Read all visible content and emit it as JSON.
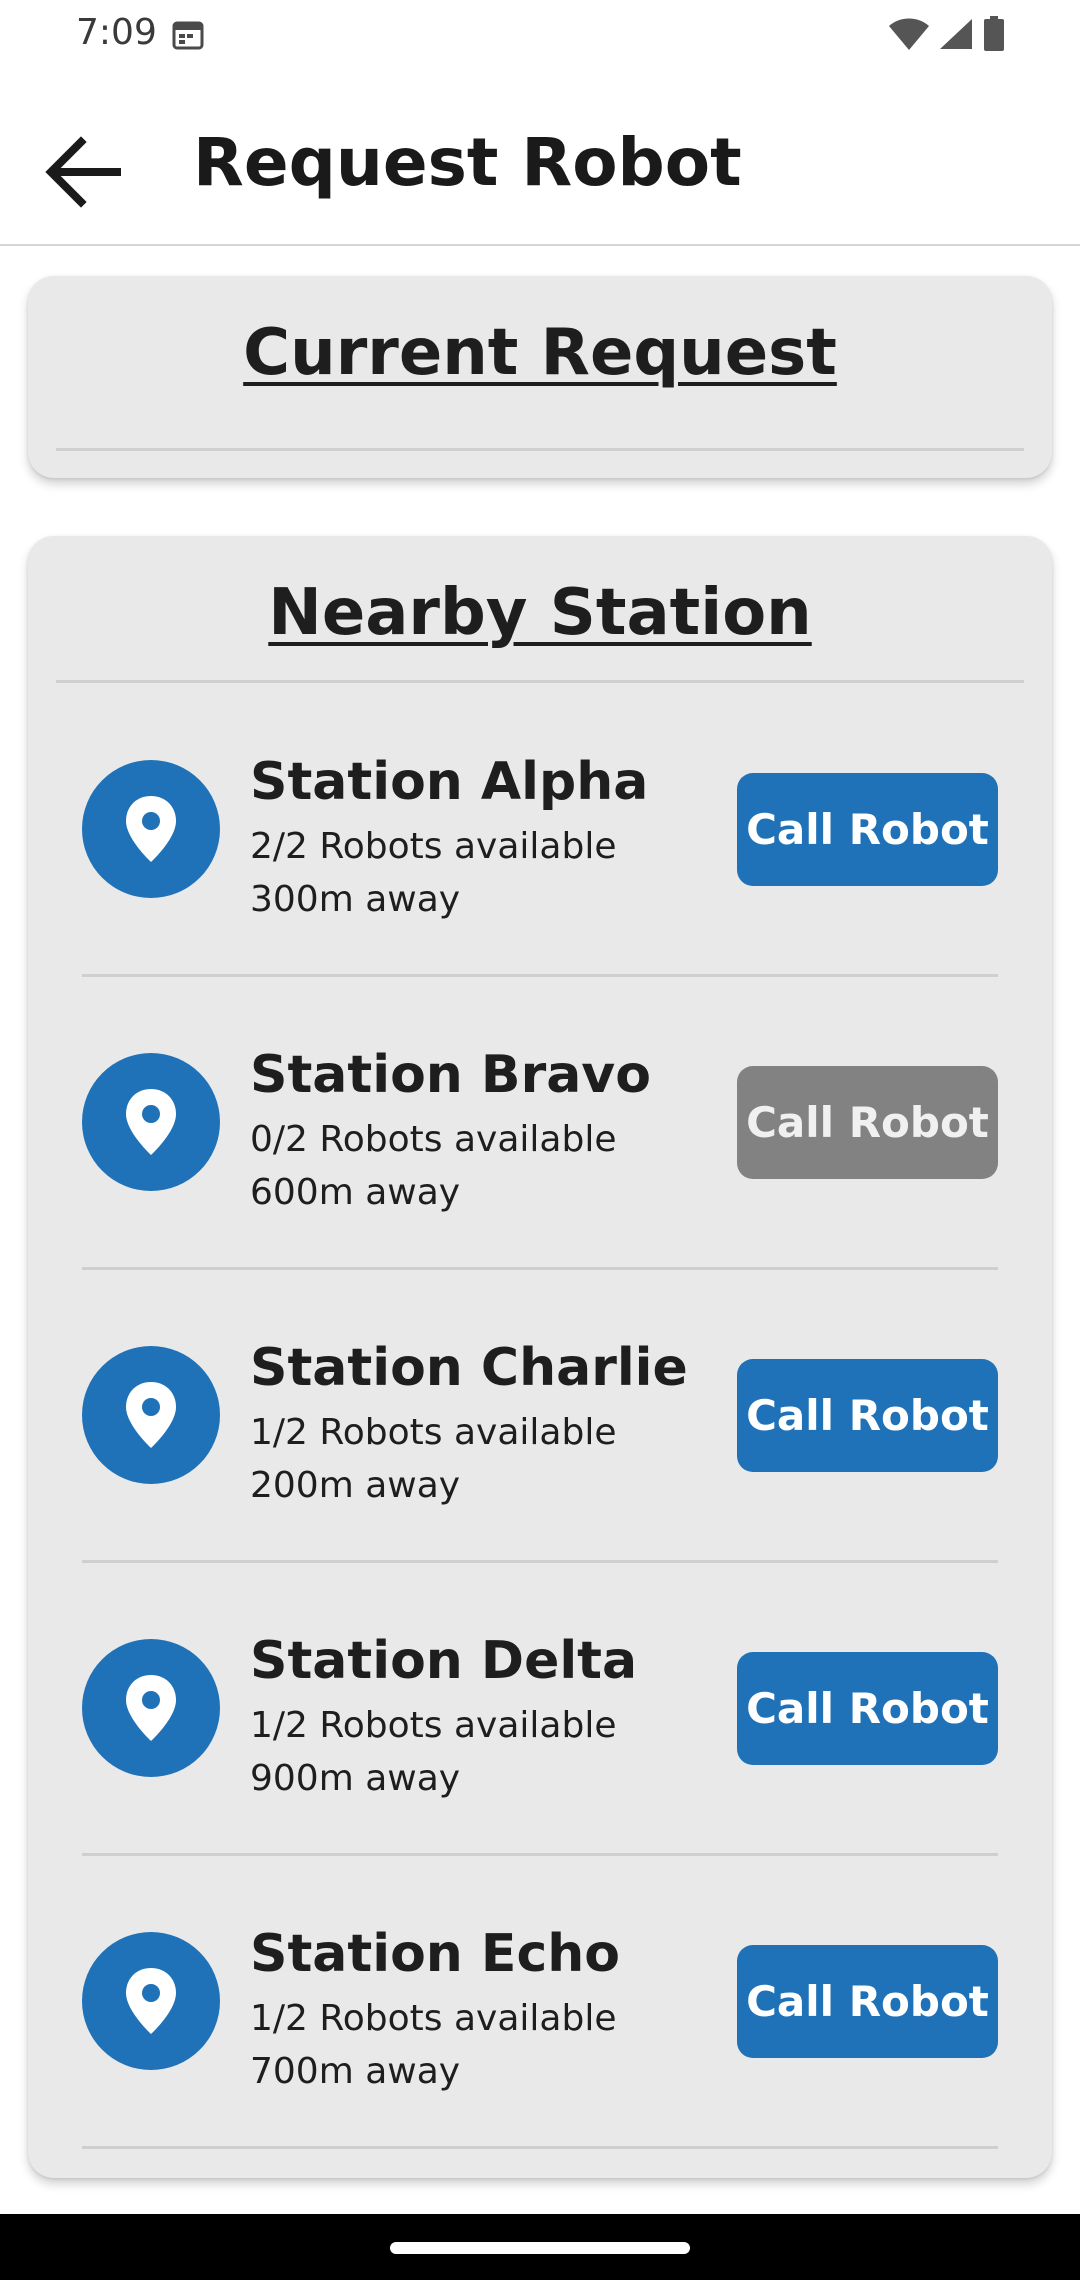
{
  "status_bar": {
    "time": "7:09",
    "icons": [
      "calendar-icon",
      "wifi-icon",
      "signal-icon",
      "battery-icon"
    ]
  },
  "app_bar": {
    "title": "Request Robot",
    "back_icon": "arrow-left-icon"
  },
  "current_request": {
    "header": "Current Request"
  },
  "nearby": {
    "header": "Nearby Station",
    "stations": [
      {
        "name": "Station Alpha",
        "availability": "2/2 Robots available",
        "distance": "300m away",
        "button": "Call Robot",
        "enabled": true
      },
      {
        "name": "Station Bravo",
        "availability": "0/2 Robots available",
        "distance": "600m away",
        "button": "Call Robot",
        "enabled": false
      },
      {
        "name": "Station Charlie",
        "availability": "1/2 Robots available",
        "distance": "200m away",
        "button": "Call Robot",
        "enabled": true
      },
      {
        "name": "Station Delta",
        "availability": "1/2 Robots available",
        "distance": "900m away",
        "button": "Call Robot",
        "enabled": true
      },
      {
        "name": "Station Echo",
        "availability": "1/2 Robots available",
        "distance": "700m away",
        "button": "Call Robot",
        "enabled": true
      }
    ]
  },
  "colors": {
    "primary": "#1f72b7",
    "disabled": "#828282",
    "card": "#e9e9e9"
  }
}
